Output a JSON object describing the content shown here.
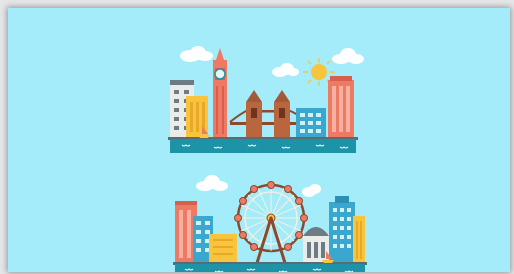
{
  "canvas": {
    "background": "#a4ecf9"
  },
  "scenes": [
    {
      "name": "london-skyline",
      "elements": [
        "clouds",
        "sun",
        "office-buildings",
        "clock-tower",
        "tower-bridge",
        "sailboat",
        "river"
      ]
    },
    {
      "name": "ferris-wheel-skyline",
      "elements": [
        "clouds",
        "ferris-wheel",
        "office-buildings",
        "dome-building",
        "sailboat",
        "river"
      ]
    }
  ],
  "colors": {
    "sky": "#a4ecf9",
    "water": "#1c93a6",
    "coral": "#ef7a64",
    "yellow": "#f7c43c",
    "grey": "#6d7b84",
    "blue": "#3aa7cf",
    "cream": "#f3efe2",
    "brown": "#8b4a2e"
  }
}
